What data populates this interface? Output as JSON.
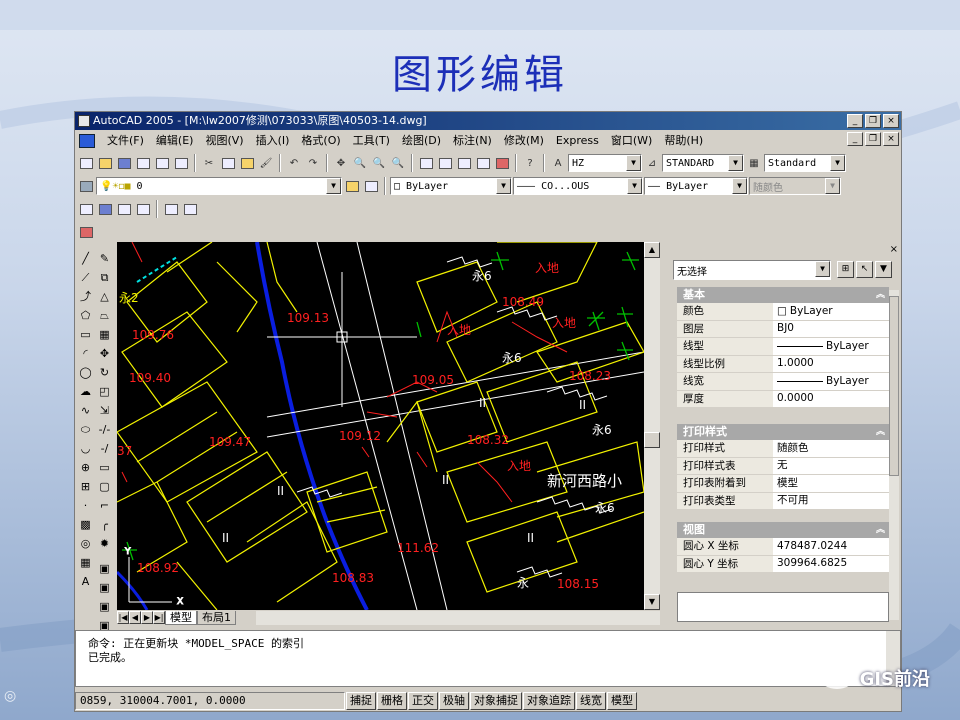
{
  "slide": {
    "title": "图形编辑"
  },
  "window": {
    "title": "AutoCAD 2005 - [M:\\lw2007修测\\073033\\原图\\40503-14.dwg]",
    "controls": [
      "_",
      "❐",
      "×"
    ]
  },
  "menu": [
    "文件(F)",
    "编辑(E)",
    "视图(V)",
    "插入(I)",
    "格式(O)",
    "工具(T)",
    "绘图(D)",
    "标注(N)",
    "修改(M)",
    "Express",
    "窗口(W)",
    "帮助(H)"
  ],
  "toolbar": {
    "text_style": "HZ",
    "dim_style": "STANDARD",
    "table_style": "Standard",
    "layer": "0",
    "color": "ByLayer",
    "linetype": "CO...OUS",
    "lineweight": "ByLayer",
    "plotstyle": "随颜色"
  },
  "drawing": {
    "elevations": [
      "109.76",
      "109.13",
      "108.49",
      "109.40",
      "109.05",
      "108.23",
      "109.47",
      "109.12",
      "108.32",
      "111.62",
      "108.92",
      "108.83",
      "108.15"
    ],
    "labels": [
      "永2",
      "永6",
      "永6",
      "永6",
      "永6",
      "永",
      "入地",
      "入地",
      "入地",
      "入地",
      "II",
      "II",
      "II",
      "II",
      "II",
      "II",
      "37"
    ],
    "street": "新河西路小"
  },
  "layout_tabs": [
    "模型",
    "布局1"
  ],
  "properties": {
    "selection": "无选择",
    "sections": [
      {
        "title": "基本",
        "rows": [
          {
            "key": "颜色",
            "value": "ByLayer",
            "swatch": "box"
          },
          {
            "key": "图层",
            "value": "BJ0"
          },
          {
            "key": "线型",
            "value": "ByLayer",
            "swatch": "line"
          },
          {
            "key": "线型比例",
            "value": "1.0000"
          },
          {
            "key": "线宽",
            "value": "ByLayer",
            "swatch": "line"
          },
          {
            "key": "厚度",
            "value": "0.0000"
          }
        ]
      },
      {
        "title": "打印样式",
        "rows": [
          {
            "key": "打印样式",
            "value": "随颜色"
          },
          {
            "key": "打印样式表",
            "value": "无"
          },
          {
            "key": "打印表附着到",
            "value": "模型"
          },
          {
            "key": "打印表类型",
            "value": "不可用"
          }
        ]
      },
      {
        "title": "视图",
        "rows": [
          {
            "key": "圆心 X 坐标",
            "value": "478487.0244"
          },
          {
            "key": "圆心 Y 坐标",
            "value": "309964.6825"
          }
        ]
      }
    ]
  },
  "command": {
    "line1": "命令: 正在更新块 *MODEL_SPACE 的索引",
    "line2": "已完成。"
  },
  "status": {
    "coords": "0859, 310004.7001, 0.0000",
    "buttons": [
      "捕捉",
      "栅格",
      "正交",
      "极轴",
      "对象捕捉",
      "对象追踪",
      "线宽",
      "模型"
    ]
  },
  "watermark": "GIS前沿",
  "colors": {
    "yellow": "#f2f200",
    "red": "#ff2020",
    "white": "#ffffff",
    "blue": "#0a1ee0",
    "green": "#00c000"
  }
}
